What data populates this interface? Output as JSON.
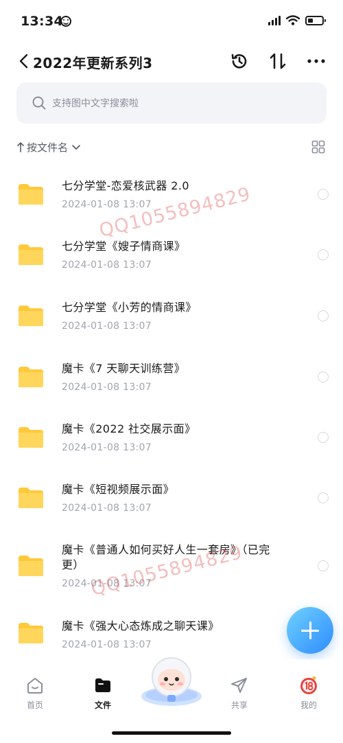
{
  "status_bar": {
    "time": "13:34"
  },
  "header": {
    "title": "2022年更新系列3"
  },
  "search": {
    "placeholder": "支持图中文字搜索啦"
  },
  "sort": {
    "label": "按文件名"
  },
  "files": [
    {
      "name": "七分学堂-恋爱核武器 2.0",
      "date": "2024-01-08 13:07"
    },
    {
      "name": "七分学堂《嫂子情商课》",
      "date": "2024-01-08 13:07"
    },
    {
      "name": "七分学堂《小芳的情商课》",
      "date": "2024-01-08 13:07"
    },
    {
      "name": "魔卡《7 天聊天训练营》",
      "date": "2024-01-08 13:07"
    },
    {
      "name": "魔卡《2022 社交展示面》",
      "date": "2024-01-08 13:07"
    },
    {
      "name": "魔卡《短视频展示面》",
      "date": "2024-01-08 13:07"
    },
    {
      "name": "魔卡《普通人如何买好人生一套房》（已完更）",
      "date": "2024-01-08 13:07"
    },
    {
      "name": "魔卡《强大心态炼成之聊天课》",
      "date": "2024-01-08 13:07"
    }
  ],
  "watermarks": [
    "QQ1055894829",
    "QQ1055894829"
  ],
  "bottom_nav": [
    {
      "label": "首页",
      "icon": "home-icon"
    },
    {
      "label": "文件",
      "icon": "folder-icon"
    },
    {
      "label": "共享",
      "icon": "send-icon"
    },
    {
      "label": "我的",
      "icon": "avatar-icon"
    }
  ],
  "colors": {
    "accent": "#2e8cff",
    "folder": "#ffc93c",
    "watermark": "#dc4646"
  }
}
